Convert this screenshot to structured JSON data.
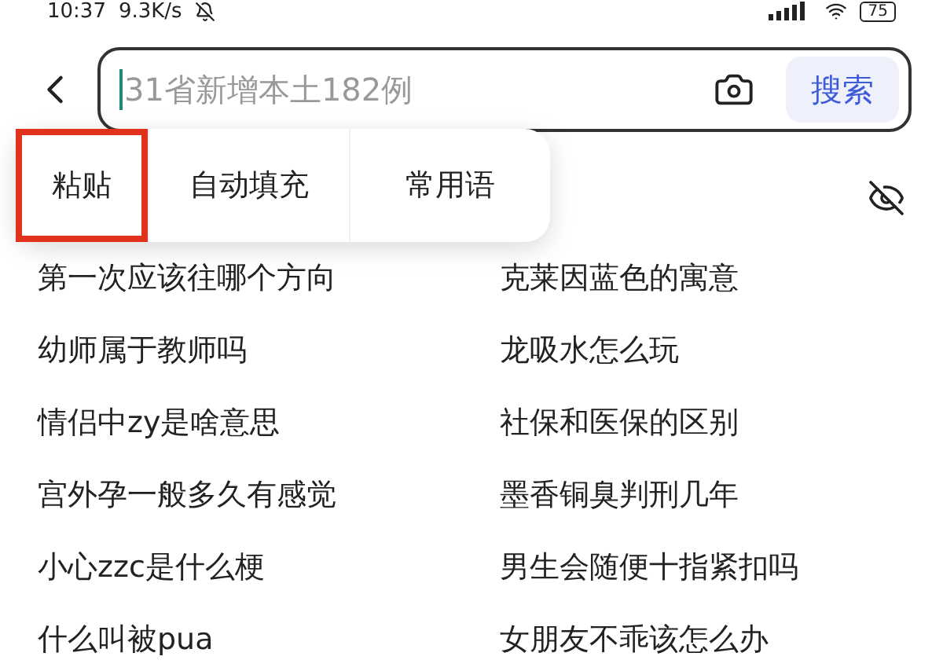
{
  "status_bar": {
    "time": "10:37",
    "speed": "9.3K/s",
    "battery": "75"
  },
  "search": {
    "placeholder": "31省新增本土182例",
    "button": "搜索"
  },
  "popup_menu": [
    {
      "label": "粘贴",
      "highlighted": true
    },
    {
      "label": "自动填充",
      "highlighted": false
    },
    {
      "label": "常用语",
      "highlighted": false
    }
  ],
  "suggestions": [
    "第一次应该往哪个方向",
    "克莱因蓝色的寓意",
    "幼师属于教师吗",
    "龙吸水怎么玩",
    "情侣中zy是啥意思",
    "社保和医保的区别",
    "宫外孕一般多久有感觉",
    "墨香铜臭判刑几年",
    "小心zzc是什么梗",
    "男生会随便十指紧扣吗",
    "什么叫被pua",
    "女朋友不乖该怎么办"
  ]
}
